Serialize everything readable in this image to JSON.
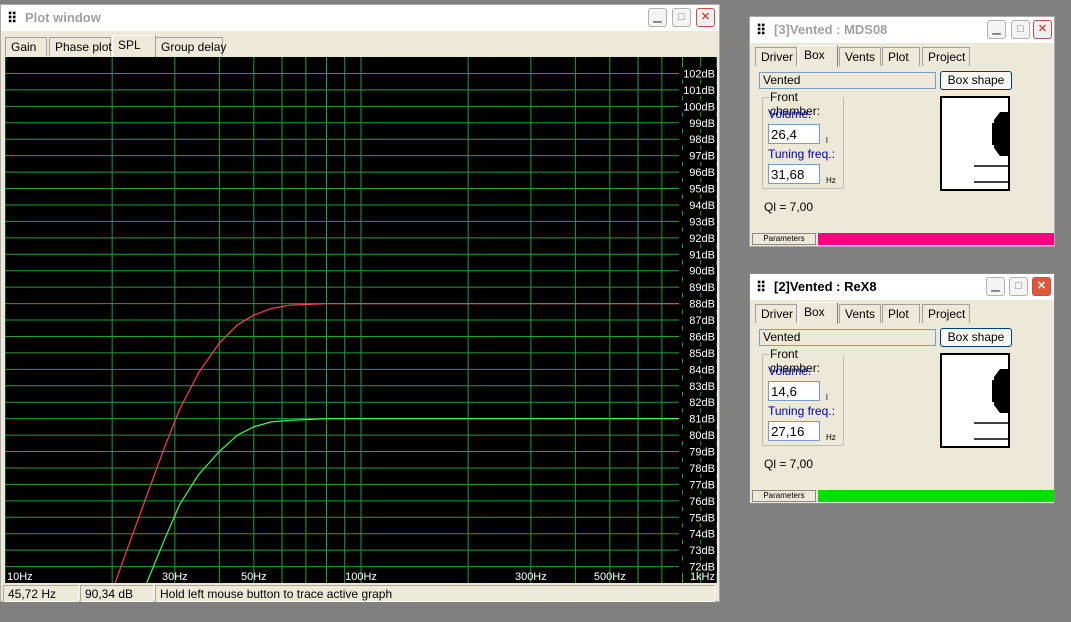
{
  "plot_window": {
    "title": "Plot window",
    "tabs": [
      {
        "label": "Gain"
      },
      {
        "label": "Phase plot"
      },
      {
        "label": "SPL"
      },
      {
        "label": "Group delay"
      }
    ],
    "status": {
      "freq": "45,72 Hz",
      "level": "90,34 dB",
      "hint": "Hold left mouse button to trace active graph"
    }
  },
  "chart_data": {
    "type": "line",
    "xscale": "log",
    "xlim": [
      10,
      1000
    ],
    "ylim": [
      71,
      103
    ],
    "x_ticks": [
      "10Hz",
      "30Hz",
      "50Hz",
      "100Hz",
      "300Hz",
      "500Hz",
      "1kHz"
    ],
    "x_tick_values": [
      10,
      30,
      50,
      100,
      300,
      500,
      1000
    ],
    "y_ticks": [
      "102dB",
      "101dB",
      "100dB",
      "99dB",
      "98dB",
      "97dB",
      "96dB",
      "95dB",
      "94dB",
      "93dB",
      "92dB",
      "91dB",
      "90dB",
      "89dB",
      "88dB",
      "87dB",
      "86dB",
      "85dB",
      "84dB",
      "83dB",
      "82dB",
      "81dB",
      "80dB",
      "79dB",
      "78dB",
      "77dB",
      "76dB",
      "75dB",
      "74dB",
      "73dB",
      "72dB"
    ],
    "y_tick_values": [
      102,
      101,
      100,
      99,
      98,
      97,
      96,
      95,
      94,
      93,
      92,
      91,
      90,
      89,
      88,
      87,
      86,
      85,
      84,
      83,
      82,
      81,
      80,
      79,
      78,
      77,
      76,
      75,
      74,
      73,
      72
    ],
    "grid": true,
    "series": [
      {
        "color": "#ff3c5a",
        "x": [
          20,
          22,
          25,
          28,
          31,
          35,
          40,
          45,
          50,
          56,
          63,
          80,
          100,
          200,
          500,
          1000
        ],
        "values": [
          70.5,
          73,
          76.3,
          79.2,
          81.6,
          83.8,
          85.6,
          86.7,
          87.3,
          87.7,
          87.9,
          88,
          88,
          88,
          88,
          88
        ]
      },
      {
        "color": "#3cff50",
        "x": [
          25,
          28,
          31,
          35,
          40,
          45,
          50,
          56,
          63,
          80,
          100,
          200,
          500,
          1000
        ],
        "values": [
          71,
          73.6,
          75.8,
          77.6,
          79,
          80,
          80.5,
          80.8,
          80.9,
          81,
          81,
          81,
          81,
          81
        ]
      }
    ]
  },
  "vented3": {
    "title": "[3]Vented : MDS08",
    "tabs": [
      {
        "label": "Driver"
      },
      {
        "label": "Box"
      },
      {
        "label": "Vents"
      },
      {
        "label": "Plot"
      },
      {
        "label": "Project"
      }
    ],
    "box_type": "Vented",
    "box_shape_button": "Box shape",
    "front_chamber": "Front chamber:",
    "volume_label": "Volume:",
    "volume_value": "26,4",
    "volume_unit": "l",
    "tuning_label": "Tuning freq.:",
    "tuning_value": "31,68",
    "tuning_unit": "Hz",
    "ql": "Ql = 7,00",
    "parameters_label": "Parameters",
    "color": "#ff0080"
  },
  "vented2": {
    "title": "[2]Vented : ReX8",
    "tabs": [
      {
        "label": "Driver"
      },
      {
        "label": "Box"
      },
      {
        "label": "Vents"
      },
      {
        "label": "Plot"
      },
      {
        "label": "Project"
      }
    ],
    "box_type": "Vented",
    "box_shape_button": "Box shape",
    "front_chamber": "Front chamber:",
    "volume_label": "Volume:",
    "volume_value": "14,6",
    "volume_unit": "l",
    "tuning_label": "Tuning freq.:",
    "tuning_value": "27,16",
    "tuning_unit": "Hz",
    "ql": "Ql = 7,00",
    "parameters_label": "Parameters",
    "color": "#00e000"
  }
}
